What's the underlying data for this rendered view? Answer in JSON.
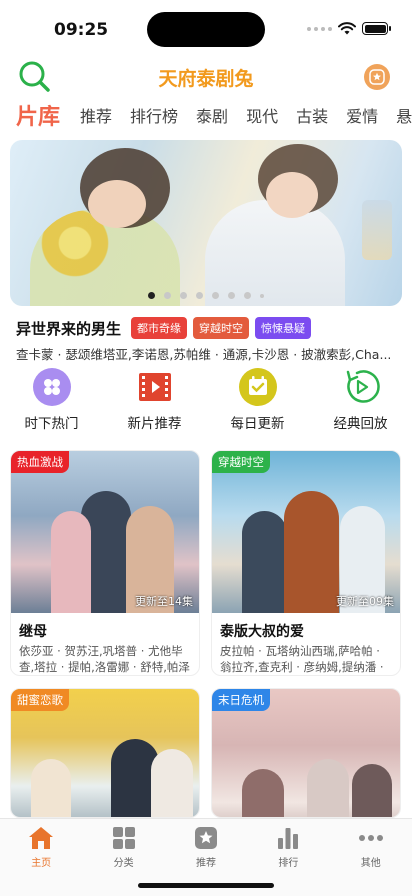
{
  "status": {
    "time": "09:25"
  },
  "header": {
    "title": "天府泰剧兔",
    "search_icon": "search-icon",
    "fav_icon": "star-badge-icon"
  },
  "tabs": [
    {
      "label": "片库",
      "active": true
    },
    {
      "label": "推荐"
    },
    {
      "label": "排行榜"
    },
    {
      "label": "泰剧"
    },
    {
      "label": "现代"
    },
    {
      "label": "古装"
    },
    {
      "label": "爱情"
    },
    {
      "label": "悬疑"
    }
  ],
  "banner": {
    "page_count": 8,
    "current_page": 1
  },
  "featured": {
    "title": "异世界来的男生",
    "tags": [
      {
        "label": "都市奇缘",
        "color": "#e8413a"
      },
      {
        "label": "穿越时空",
        "color": "#e35b3d"
      },
      {
        "label": "惊悚悬疑",
        "color": "#7b4cf0"
      }
    ],
    "cast": "查卡蒙 · 瑟颂维塔亚,李诺恩,苏帕维 · 通源,卡沙恩 · 披澈索彭,Cha..."
  },
  "quick_menu": [
    {
      "label": "时下热门",
      "icon": "flower-icon"
    },
    {
      "label": "新片推荐",
      "icon": "film-icon"
    },
    {
      "label": "每日更新",
      "icon": "calendar-check-icon"
    },
    {
      "label": "经典回放",
      "icon": "replay-icon"
    }
  ],
  "cards": [
    {
      "badge": "热血激战",
      "badge_color": "#e8232a",
      "update": "更新至14集",
      "title": "继母",
      "cast": "依莎亚 · 贺苏汪,巩塔普 · 尤他毕查,塔拉 · 提帕,洛雷娜 · 舒特,帕泽功..."
    },
    {
      "badge": "穿越时空",
      "badge_color": "#2db24a",
      "update": "更新至09集",
      "title": "泰版大叔的爱",
      "cast": "皮拉帕 · 瓦塔纳汕西瑞,萨哈帕 · 翁拉齐,查克利 · 彦纳姆,提纳潘 · 挡..."
    },
    {
      "badge": "甜蜜恋歌",
      "badge_color": "#f08a24",
      "update": "",
      "title": "",
      "cast": ""
    },
    {
      "badge": "末日危机",
      "badge_color": "#2e86e8",
      "update": "",
      "title": "",
      "cast": ""
    }
  ],
  "bottom_nav": [
    {
      "label": "主页",
      "icon": "home-icon",
      "active": true
    },
    {
      "label": "分类",
      "icon": "grid-icon"
    },
    {
      "label": "推荐",
      "icon": "star-icon"
    },
    {
      "label": "排行",
      "icon": "bar-chart-icon"
    },
    {
      "label": "其他",
      "icon": "more-icon"
    }
  ],
  "colors": {
    "accent": "#f29a1e",
    "active_tab": "#f0654a",
    "nav_active": "#e8742c"
  }
}
